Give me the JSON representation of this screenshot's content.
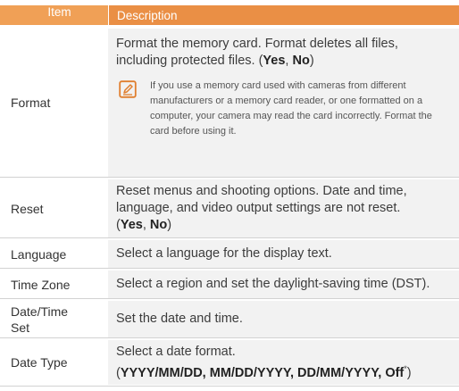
{
  "header": {
    "item": "Item",
    "description": "Description"
  },
  "rows": [
    {
      "item": "Format",
      "desc_text": "Format the memory card. Format deletes all files, including protected files. (",
      "opt1": "Yes",
      "comma": ", ",
      "opt2": "No",
      "close": ")",
      "note": "If you use a memory card used with cameras from different manufacturers or a memory card reader, or one formatted on a computer, your camera may read the card incorrectly. Format the card before using it.",
      "note_icon": "note-pencil-icon"
    },
    {
      "item": "Reset",
      "desc_text": "Reset menus and shooting options. Date and time, language, and video output settings are not reset.",
      "open": "(",
      "opt1": "Yes",
      "comma": ", ",
      "opt2": "No",
      "close": ")"
    },
    {
      "item": "Language",
      "desc_text": "Select a language for the display text."
    },
    {
      "item": "Time Zone",
      "desc_text": "Select a region and set the daylight-saving time (DST)."
    },
    {
      "item": "Date/Time Set",
      "desc_text": "Set the date and time."
    },
    {
      "item": "Date Type",
      "desc_text": "Select a date format.",
      "open": "(",
      "opts": "YYYY/MM/DD, MM/DD/YYYY, DD/MM/YYYY, Off",
      "star": "*",
      "close": ")"
    }
  ],
  "colors": {
    "header_left": "#f0a056",
    "header_right": "#ea8f45",
    "desc_bg": "#f2f2f2",
    "icon": "#e07f2f"
  }
}
